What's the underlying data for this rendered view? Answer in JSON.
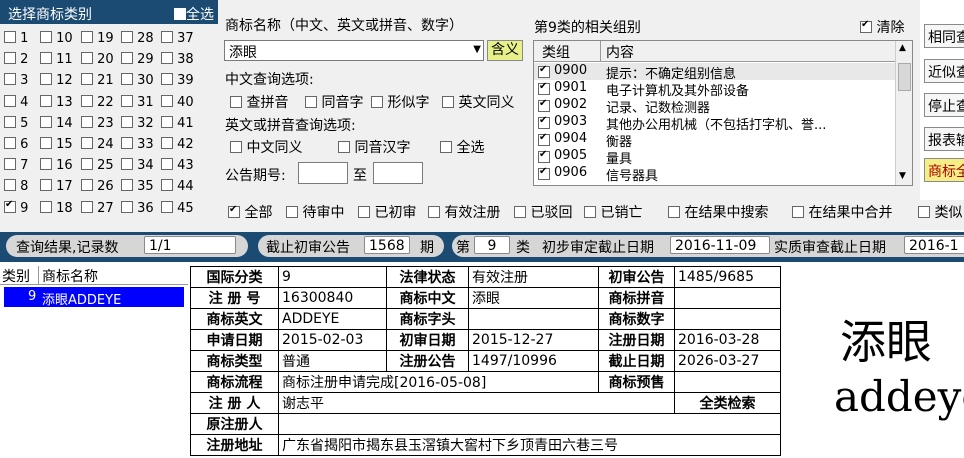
{
  "category_panel": {
    "title": "选择商标类别",
    "select_all_label": "全选",
    "categories": [
      "1",
      "2",
      "3",
      "4",
      "5",
      "6",
      "7",
      "8",
      "9",
      "10",
      "11",
      "12",
      "13",
      "14",
      "15",
      "16",
      "17",
      "18",
      "19",
      "20",
      "21",
      "22",
      "23",
      "24",
      "25",
      "26",
      "27",
      "28",
      "29",
      "30",
      "31",
      "32",
      "33",
      "34",
      "35",
      "36",
      "37",
      "38",
      "39",
      "40",
      "41",
      "42",
      "43",
      "44",
      "45"
    ],
    "checked": [
      "9"
    ]
  },
  "query": {
    "name_label": "商标名称（中文、英文或拼音、数字）",
    "name_value": "添眼",
    "meaning_button": "含义",
    "cn_options_label": "中文查询选项:",
    "cn_options": [
      "查拼音",
      "同音字",
      "形似字",
      "英文同义"
    ],
    "en_options_label": "英文或拼音查询选项:",
    "en_options": [
      "中文同义",
      "同音汉字",
      "全选"
    ],
    "issue_label": "公告期号:",
    "issue_to": "至"
  },
  "groups": {
    "title": "第9类的相关组别",
    "clear_label": "清除",
    "col_group": "类组",
    "col_content": "内容",
    "rows": [
      {
        "code": "0900",
        "text": "提示：不确定组别信息"
      },
      {
        "code": "0901",
        "text": "电子计算机及其外部设备"
      },
      {
        "code": "0902",
        "text": "记录、记数检测器"
      },
      {
        "code": "0903",
        "text": "其他办公用机械（不包括打字机、誉..."
      },
      {
        "code": "0904",
        "text": "衡器"
      },
      {
        "code": "0905",
        "text": "量具"
      },
      {
        "code": "0906",
        "text": "信号器具"
      }
    ]
  },
  "side_buttons": [
    "相同查",
    "近似查",
    "停止查",
    "报表输",
    "商标全"
  ],
  "filters": [
    "全部",
    "待审中",
    "已初审",
    "有效注册",
    "已驳回",
    "已销亡",
    "在结果中搜索",
    "在结果中合并",
    "类似"
  ],
  "status": {
    "result_label": "查询结果,记录数",
    "result_count": "1/1",
    "cutoff_label": "截止初审公告",
    "cutoff_value": "1568",
    "cutoff_unit": "期",
    "class_prefix": "第",
    "class_value": "9",
    "class_suffix": "类",
    "prelim_label": "初步审定截止日期",
    "prelim_date": "2016-11-09",
    "substantive_label": "实质审查截止日期",
    "substantive_date": "2016-1"
  },
  "results": {
    "col_class": "类别",
    "col_name": "商标名称",
    "rows": [
      {
        "class": "9",
        "name": "添眼ADDEYE"
      }
    ]
  },
  "detail": {
    "k_class": "国际分类",
    "v_class": "9",
    "k_legal": "法律状态",
    "v_legal": "有效注册",
    "k_prelim": "初审公告",
    "v_prelim": "1485/9685",
    "k_regno": "注 册 号",
    "v_regno": "16300840",
    "k_cn": "商标中文",
    "v_cn": "添眼",
    "k_py": "商标拼音",
    "v_py": "",
    "k_en": "商标英文",
    "v_en": "ADDEYE",
    "k_head": "商标字头",
    "v_head": "",
    "k_num": "商标数字",
    "v_num": "",
    "k_apply": "申请日期",
    "v_apply": "2015-02-03",
    "k_prelim_date": "初审日期",
    "v_prelim_date": "2015-12-27",
    "k_reg_date": "注册日期",
    "v_reg_date": "2016-03-28",
    "k_type": "商标类型",
    "v_type": "普通",
    "k_reg_notice": "注册公告",
    "v_reg_notice": "1497/10996",
    "k_expire": "截止日期",
    "v_expire": "2026-03-27",
    "k_flow": "商标流程",
    "v_flow": "商标注册申请完成[2016-05-08]",
    "k_preview": "商标预售",
    "v_preview": "",
    "k_reg_person": "注 册 人",
    "v_reg_person": "谢志平",
    "all_class_search": "全类检索",
    "k_orig_person": "原注册人",
    "v_orig_person": "",
    "k_address": "注册地址",
    "v_address": "广东省揭阳市揭东县玉滘镇大窖村下乡顶青田六巷三号"
  },
  "preview": {
    "cn": "添眼",
    "en": "addeye"
  }
}
